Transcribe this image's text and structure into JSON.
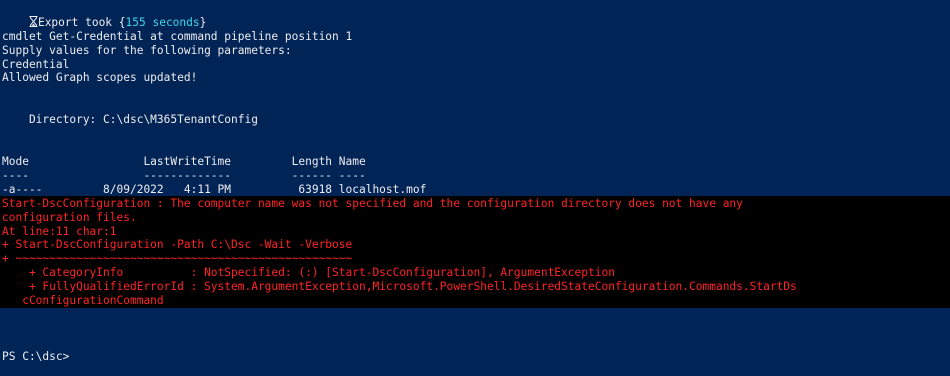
{
  "console": {
    "export": {
      "label": "Export took ",
      "open_brace": "{",
      "duration": "155 seconds",
      "close_brace": "}"
    },
    "lines": {
      "cmdlet": "cmdlet Get-Credential at command pipeline position 1",
      "supply": "Supply values for the following parameters:",
      "credential": "Credential",
      "graph": "Allowed Graph scopes updated!",
      "directory": "    Directory: C:\\dsc\\M365TenantConfig",
      "header": "Mode                 LastWriteTime         Length Name",
      "dashes": "----                 -------------         ------ ----",
      "row": "-a----         8/09/2022   4:11 PM          63918 localhost.mof"
    },
    "error": {
      "line1": "Start-DscConfiguration : The computer name was not specified and the configuration directory does not have any",
      "line2": "configuration files.",
      "line3": "At line:11 char:1",
      "line4": "+ Start-DscConfiguration -Path C:\\Dsc -Wait -Verbose",
      "line5": "+ ~~~~~~~~~~~~~~~~~~~~~~~~~~~~~~~~~~~~~~~~~~~~~~~~~~",
      "line6": "    + CategoryInfo          : NotSpecified: (:) [Start-DscConfiguration], ArgumentException",
      "line7": "    + FullyQualifiedErrorId : System.ArgumentException,Microsoft.PowerShell.DesiredStateConfiguration.Commands.StartDs",
      "line8": "   cConfigurationCommand"
    },
    "prompt": "PS C:\\dsc>",
    "colors": {
      "background": "#012456",
      "foreground": "#eeedf0",
      "error_text": "#ff2424",
      "error_background": "#000000",
      "highlight": "#3fd6e8"
    }
  }
}
